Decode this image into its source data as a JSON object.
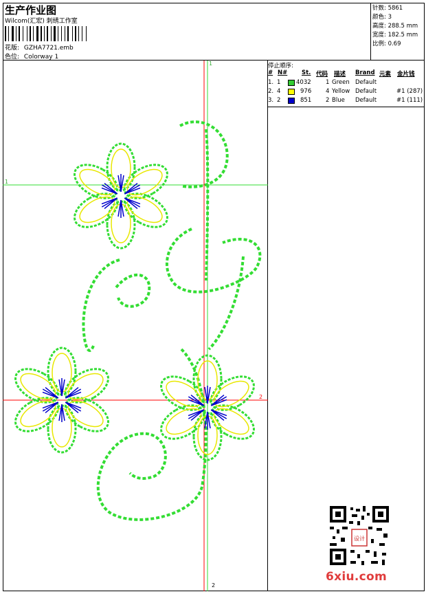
{
  "header": {
    "title": "生产作业图",
    "company": "Wilcom(汇宏) 刺绣工作室",
    "design_label": "花版:",
    "design_value": "GZHA7721.emb",
    "colorway_label": "色位:",
    "colorway_value": "Colorway 1"
  },
  "stats": {
    "stitches": "针数: 5861",
    "colors": "颜色: 3",
    "height": "高度: 288.5 mm",
    "width": "宽度: 182.5 mm",
    "scale": "比例: 0.69"
  },
  "stop_sequence": {
    "title": "停止顺序:",
    "headers": [
      "#",
      "N#",
      "St.",
      "代码",
      "描述",
      "Brand",
      "元素",
      "金片钱"
    ],
    "rows": [
      {
        "idx": "1.",
        "needle": "1",
        "color": "#33cc33",
        "stitches": "4032",
        "code": "1",
        "desc": "Green",
        "brand": "Default",
        "element": "",
        "sequin": ""
      },
      {
        "idx": "2.",
        "needle": "4",
        "color": "#ffff00",
        "stitches": "976",
        "code": "4",
        "desc": "Yellow",
        "brand": "Default",
        "element": "",
        "sequin": "#1 (287)"
      },
      {
        "idx": "3.",
        "needle": "2",
        "color": "#0000cc",
        "stitches": "851",
        "code": "2",
        "desc": "Blue",
        "brand": "Default",
        "element": "",
        "sequin": "#1 (111)"
      }
    ]
  },
  "guides": {
    "h1": "1",
    "v1": "1",
    "h2": "2",
    "v2": "2"
  },
  "logo": {
    "text": "6xiu.com",
    "stamp": "设计"
  },
  "colors": {
    "green": "#33dd33",
    "yellow": "#e8e800",
    "blue": "#0000cc",
    "red": "#ff0000"
  }
}
